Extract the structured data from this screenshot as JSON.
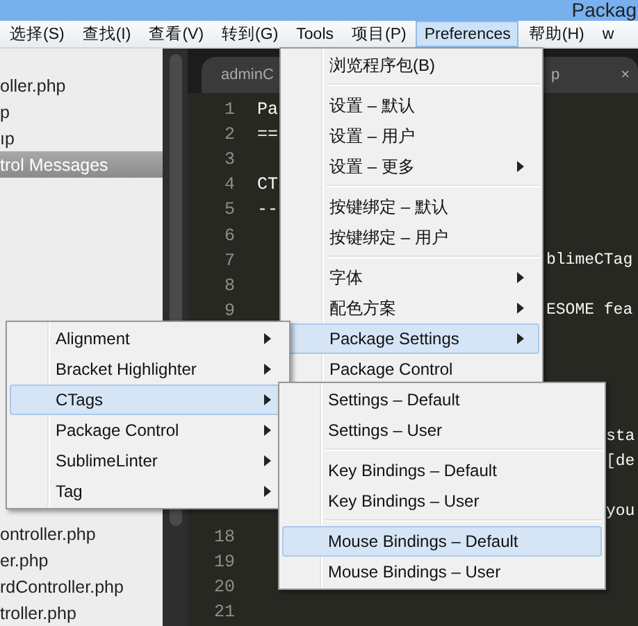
{
  "title_bar": {
    "title": "Packag"
  },
  "menu_bar": [
    {
      "label": "选择(S)",
      "selected": false
    },
    {
      "label": "查找(I)",
      "selected": false
    },
    {
      "label": "查看(V)",
      "selected": false
    },
    {
      "label": "转到(G)",
      "selected": false
    },
    {
      "label": "Tools",
      "selected": false
    },
    {
      "label": "项目(P)",
      "selected": false
    },
    {
      "label": "Preferences",
      "selected": true
    },
    {
      "label": "帮助(H)",
      "selected": false
    },
    {
      "label": "w",
      "selected": false
    }
  ],
  "sidebar": {
    "items": [
      {
        "kind": "file",
        "label": "oller.php",
        "selected": false
      },
      {
        "kind": "file",
        "label": "p",
        "selected": false
      },
      {
        "kind": "file",
        "label": "ıp",
        "selected": false
      },
      {
        "kind": "file",
        "label": "trol Messages",
        "selected": true
      },
      {
        "kind": "blank"
      },
      {
        "kind": "blank"
      },
      {
        "kind": "blank"
      },
      {
        "kind": "blank"
      },
      {
        "kind": "blank"
      },
      {
        "kind": "blank"
      },
      {
        "kind": "blank"
      },
      {
        "kind": "blank"
      },
      {
        "kind": "blank"
      },
      {
        "kind": "blank"
      },
      {
        "kind": "blank"
      },
      {
        "kind": "blank"
      },
      {
        "kind": "blank"
      },
      {
        "kind": "file",
        "label": "ontroller.php",
        "selected": false
      },
      {
        "kind": "file",
        "label": "er.php",
        "selected": false
      },
      {
        "kind": "file",
        "label": "rdController.php",
        "selected": false
      },
      {
        "kind": "file",
        "label": "troller.php",
        "selected": false
      }
    ]
  },
  "editor": {
    "tabs": [
      {
        "label": "adminC"
      },
      {
        "label": "p",
        "close": "×"
      }
    ],
    "lines": [
      {
        "number": "1",
        "text": "Pa"
      },
      {
        "number": "2",
        "text": "=="
      },
      {
        "number": "3"
      },
      {
        "number": "4",
        "text": "CT"
      },
      {
        "number": "5",
        "text": "--"
      },
      {
        "number": "6"
      },
      {
        "number": "7"
      },
      {
        "number": "8"
      },
      {
        "number": "9"
      }
    ],
    "fragments": [
      {
        "text": "blimeCTag"
      },
      {
        "text": "ESOME fea"
      },
      {
        "text": "sta"
      },
      {
        "text": "[de"
      },
      {
        "text": "you"
      }
    ],
    "lower_lines": [
      {
        "number": "18"
      },
      {
        "number": "19"
      },
      {
        "number": "20"
      },
      {
        "number": "21"
      }
    ]
  },
  "menus": [
    {
      "items": [
        {
          "kind": "item",
          "label": "浏览程序包(B)",
          "submenu": false,
          "selected": false
        },
        {
          "kind": "separator"
        },
        {
          "kind": "item",
          "label": "设置 – 默认",
          "submenu": false,
          "selected": false
        },
        {
          "kind": "item",
          "label": "设置 – 用户",
          "submenu": false,
          "selected": false
        },
        {
          "kind": "item",
          "label": "设置 – 更多",
          "submenu": true,
          "selected": false
        },
        {
          "kind": "separator"
        },
        {
          "kind": "item",
          "label": "按键绑定 – 默认",
          "submenu": false,
          "selected": false
        },
        {
          "kind": "item",
          "label": "按键绑定 – 用户",
          "submenu": false,
          "selected": false
        },
        {
          "kind": "separator"
        },
        {
          "kind": "item",
          "label": "字体",
          "submenu": true,
          "selected": false
        },
        {
          "kind": "item",
          "label": "配色方案",
          "submenu": true,
          "selected": false
        },
        {
          "kind": "item",
          "label": "Package Settings",
          "submenu": true,
          "selected": true
        },
        {
          "kind": "item",
          "label": "Package Control",
          "submenu": false,
          "selected": false
        }
      ]
    },
    {
      "items": [
        {
          "kind": "item",
          "label": "Alignment",
          "submenu": true,
          "selected": false
        },
        {
          "kind": "item",
          "label": "Bracket Highlighter",
          "submenu": true,
          "selected": false
        },
        {
          "kind": "item",
          "label": "CTags",
          "submenu": true,
          "selected": true
        },
        {
          "kind": "item",
          "label": "Package Control",
          "submenu": true,
          "selected": false
        },
        {
          "kind": "item",
          "label": "SublimeLinter",
          "submenu": true,
          "selected": false
        },
        {
          "kind": "item",
          "label": "Tag",
          "submenu": true,
          "selected": false
        }
      ]
    },
    {
      "items": [
        {
          "kind": "item",
          "label": "Settings – Default",
          "submenu": false,
          "selected": false
        },
        {
          "kind": "item",
          "label": "Settings – User",
          "submenu": false,
          "selected": false
        },
        {
          "kind": "separator"
        },
        {
          "kind": "item",
          "label": "Key Bindings – Default",
          "submenu": false,
          "selected": false
        },
        {
          "kind": "item",
          "label": "Key Bindings – User",
          "submenu": false,
          "selected": false
        },
        {
          "kind": "separator"
        },
        {
          "kind": "item",
          "label": "Mouse Bindings – Default",
          "submenu": false,
          "selected": true
        },
        {
          "kind": "item",
          "label": "Mouse Bindings – User",
          "submenu": false,
          "selected": false
        }
      ]
    }
  ]
}
